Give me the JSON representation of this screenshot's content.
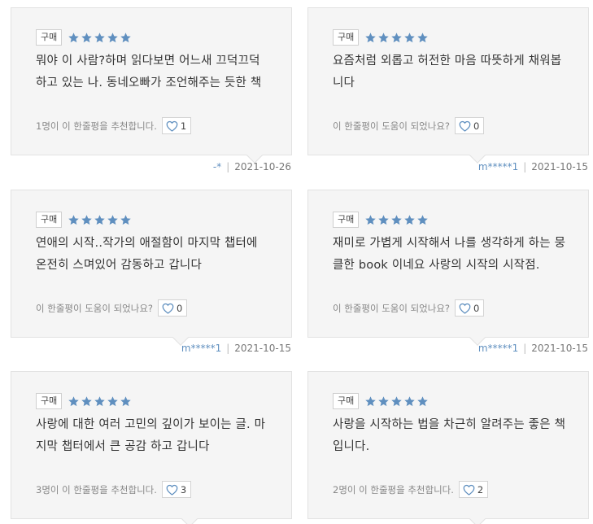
{
  "colors": {
    "accent": "#5f8fbf",
    "card_bg": "#f5f5f5"
  },
  "reviews": [
    {
      "badge": "구매",
      "rating": 5,
      "text": "뭐야 이 사람?하며 읽다보면 어느새 끄덕끄덕 하고 있는 나. 동네오빠가 조언해주는 듯한 책",
      "recommend_text": "1명이 이 한줄평을 추천합니다.",
      "likes": "1",
      "author": "-*",
      "date": "2021-10-26"
    },
    {
      "badge": "구매",
      "rating": 5,
      "text": "요즘처럼 외롭고 허전한 마음 따뜻하게 채워봅니다",
      "recommend_text": "이 한줄평이 도움이 되었나요?",
      "likes": "0",
      "author": "m*****1",
      "date": "2021-10-15"
    },
    {
      "badge": "구매",
      "rating": 5,
      "text": "연애의 시작..작가의 애절함이 마지막 챕터에 온전히 스며있어 감동하고 갑니다",
      "recommend_text": "이 한줄평이 도움이 되었나요?",
      "likes": "0",
      "author": "m*****1",
      "date": "2021-10-15"
    },
    {
      "badge": "구매",
      "rating": 5,
      "text": "재미로 가볍게 시작해서 나를 생각하게 하는 뭉클한 book 이네요 사랑의 시작의 시작점.",
      "recommend_text": "이 한줄평이 도움이 되었나요?",
      "likes": "0",
      "author": "m*****1",
      "date": "2021-10-15"
    },
    {
      "badge": "구매",
      "rating": 5,
      "text": "사랑에 대한 여러 고민의 깊이가 보이는 글. 마지막 챕터에서 큰 공감 하고 갑니다",
      "recommend_text": "3명이 이 한줄평을 추천합니다.",
      "likes": "3",
      "author": "",
      "date": ""
    },
    {
      "badge": "구매",
      "rating": 5,
      "text": "사랑을 시작하는 법을 차근히 알려주는 좋은 책입니다.",
      "recommend_text": "2명이 이 한줄평을 추천합니다.",
      "likes": "2",
      "author": "",
      "date": ""
    }
  ]
}
